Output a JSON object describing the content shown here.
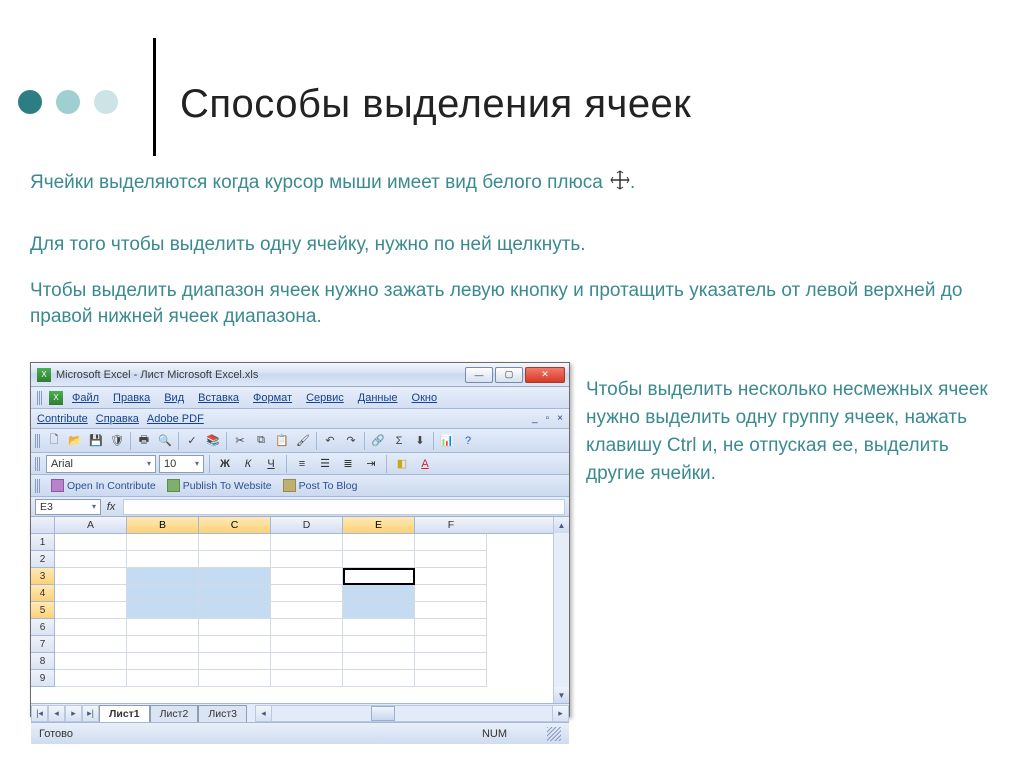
{
  "decor_colors": [
    "#2d7e83",
    "#9fcfd1",
    "#cce4e5"
  ],
  "title": "Способы выделения ячеек",
  "text_color": "#3a8a8f",
  "paragraphs": {
    "p1": "Ячейки выделяются когда курсор мыши имеет вид белого плюса",
    "p2": "Для того чтобы выделить одну ячейку, нужно по ней щелкнуть.",
    "p3": "Чтобы выделить диапазон ячеек нужно зажать левую кнопку и протащить указатель от левой верхней до правой нижней ячеек диапазона.",
    "side": "Чтобы выделить несколько несмежных ячеек нужно выделить одну группу ячеек, нажать клавишу Ctrl и, не отпуская ее, выделить другие ячейки."
  },
  "excel": {
    "title": "Microsoft Excel - Лист Microsoft Excel.xls",
    "menu": [
      "Файл",
      "Правка",
      "Вид",
      "Вставка",
      "Формат",
      "Сервис",
      "Данные",
      "Окно"
    ],
    "menu2": {
      "contribute": "Contribute",
      "help": "Справка",
      "adobe": "Adobe PDF"
    },
    "font_name": "Arial",
    "font_size": "10",
    "fmt": {
      "bold": "Ж",
      "italic": "К",
      "under": "Ч"
    },
    "contribute_bar": {
      "open": "Open In Contribute",
      "publish": "Publish To Website",
      "post": "Post To Blog"
    },
    "name_box": "E3",
    "fx_label": "fx",
    "columns": [
      "A",
      "B",
      "C",
      "D",
      "E",
      "F"
    ],
    "selected_cols": [
      "B",
      "C",
      "E"
    ],
    "selected_rows": [
      3,
      4,
      5
    ],
    "rows_count": 9,
    "sheets": [
      "Лист1",
      "Лист2",
      "Лист3"
    ],
    "status_ready": "Готово",
    "status_num": "NUM"
  }
}
